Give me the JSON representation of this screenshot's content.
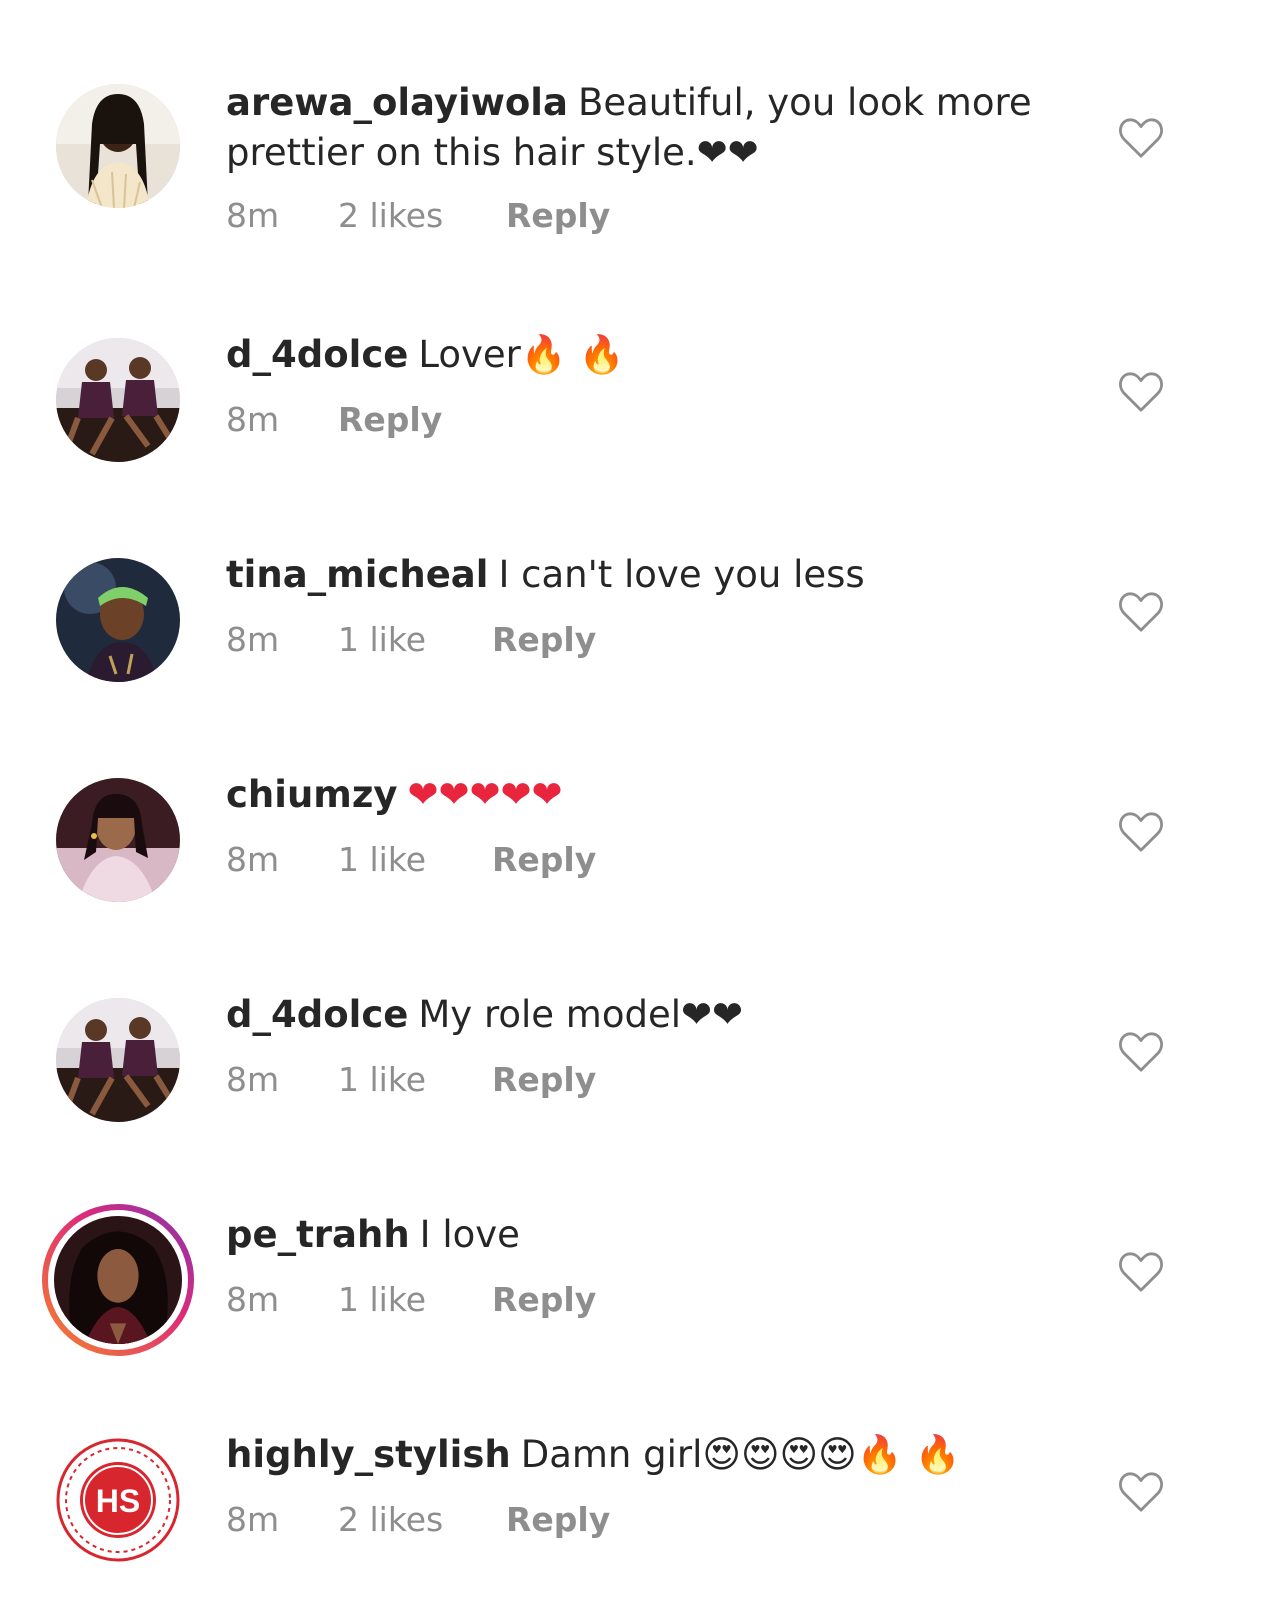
{
  "comments": [
    {
      "username": "arewa_olayiwola",
      "text": "Beautiful, you look more prettier on this hair style.❤❤",
      "time": "8m",
      "likes": "2 likes",
      "reply": "Reply",
      "has_story_ring": false,
      "avatar_icon": "profile-photo-woman-braids"
    },
    {
      "username": "d_4dolce",
      "text": "Lover🔥 🔥",
      "time": "8m",
      "likes": "",
      "reply": "Reply",
      "has_story_ring": false,
      "avatar_icon": "profile-photo-two-women-sofa"
    },
    {
      "username": "tina_micheal",
      "text": "I can't love you less ",
      "time": "8m",
      "likes": "1 like",
      "reply": "Reply",
      "has_story_ring": false,
      "avatar_icon": "profile-photo-woman-headband"
    },
    {
      "username": "chiumzy",
      "text": "❤❤❤❤❤",
      "time": "8m",
      "likes": "1 like",
      "reply": "Reply",
      "has_story_ring": false,
      "avatar_icon": "profile-photo-woman-smiling"
    },
    {
      "username": "d_4dolce",
      "text": "My role model❤❤",
      "time": "8m",
      "likes": "1 like",
      "reply": "Reply",
      "has_story_ring": false,
      "avatar_icon": "profile-photo-two-women-sofa"
    },
    {
      "username": "pe_trahh",
      "text": "I love",
      "time": "8m",
      "likes": "1 like",
      "reply": "Reply",
      "has_story_ring": true,
      "avatar_icon": "profile-photo-woman-curly-hair"
    },
    {
      "username": "highly_stylish",
      "text": "Damn girl😍😍😍😍🔥 🔥",
      "time": "8m",
      "likes": "2 likes",
      "reply": "Reply",
      "has_story_ring": false,
      "avatar_icon": "hs-logo",
      "avatar_logo_text": "HS"
    }
  ],
  "colors": {
    "text": "#262626",
    "meta": "#8e8e8e",
    "heart_outline": "#8e8e8e",
    "emoji_heart": "#e8253d",
    "story_ring_start": "#f58529",
    "story_ring_end": "#dd2a7b",
    "hs_logo": "#d7262e"
  },
  "icons": {
    "like": "heart-outline-icon"
  }
}
